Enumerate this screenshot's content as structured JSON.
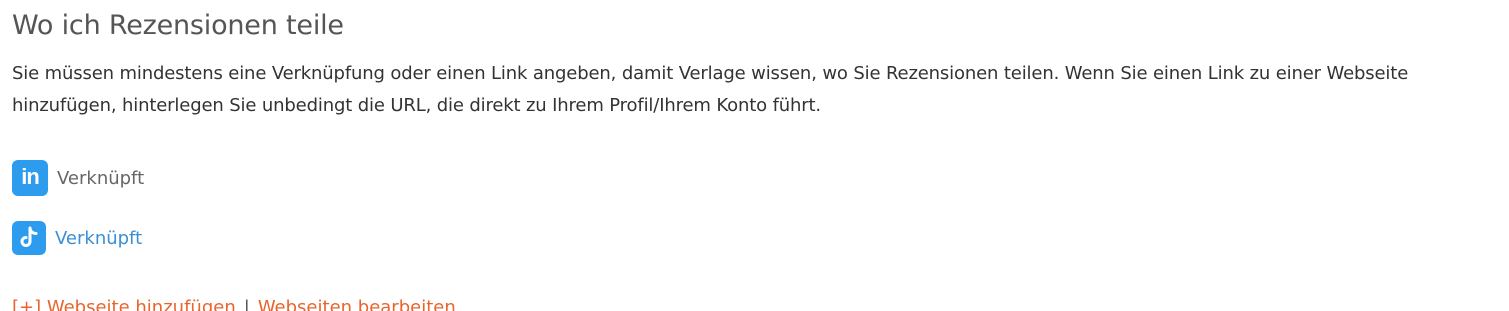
{
  "section": {
    "title": "Wo ich Rezensionen teile",
    "description": "Sie müssen mindestens eine Verknüpfung oder einen Link angeben, damit Verlage wissen, wo Sie Rezensionen teilen. Wenn Sie einen Link zu einer Webseite hinzufügen, hinterlegen Sie unbedingt die URL, die direkt zu Ihrem Profil/Ihrem Konto führt."
  },
  "social": [
    {
      "icon": "linkedin-icon",
      "icon_text": "in",
      "status": "Verknüpft"
    },
    {
      "icon": "tiktok-icon",
      "status": "Verknüpft"
    }
  ],
  "actions": {
    "add_website": "[+] Webseite hinzufügen",
    "separator": "|",
    "edit_websites": "Webseiten bearbeiten"
  },
  "colors": {
    "icon_bg": "#2d9cef",
    "link_blue": "#3a8fd6",
    "action_orange": "#e8642c",
    "title_gray": "#555555"
  }
}
